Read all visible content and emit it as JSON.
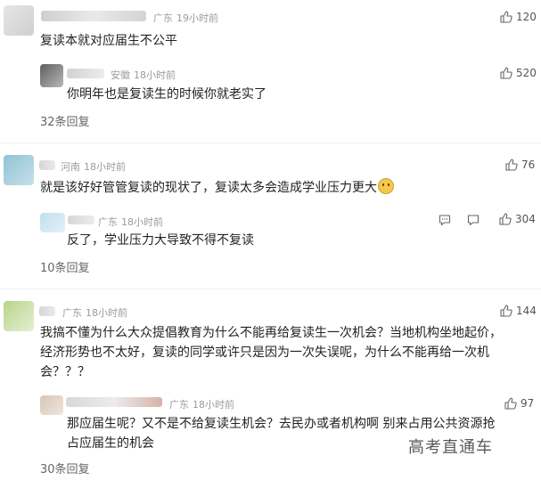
{
  "thread1": {
    "comment": {
      "location": "广东",
      "time": "19小时前",
      "text": "复读本就对应届生不公平",
      "likes": "120"
    },
    "reply": {
      "location": "安徽",
      "time": "18小时前",
      "text": "你明年也是复读生的时候你就老实了",
      "likes": "520"
    },
    "more_replies": "32条回复",
    "avatar_color": "#d9d9d9"
  },
  "thread2": {
    "comment": {
      "location": "河南",
      "time": "18小时前",
      "text": "就是该好好管管复读的现状了，复读太多会造成学业压力更大",
      "likes": "76",
      "emoji_icon": "smiling-face-emoji"
    },
    "reply": {
      "location": "广东",
      "time": "18小时前",
      "text": "反了，学业压力大导致不得不复读",
      "likes": "304"
    },
    "more_replies": "10条回复",
    "avatar_color": "#7fb4c9"
  },
  "thread3": {
    "comment": {
      "location": "广东",
      "time": "18小时前",
      "lines": [
        "我搞不懂为什么大众提倡教育为什么不能再给复读生一次机会？当地机构坐地起价，",
        "经济形势也不太好，复读的同学或许只是因为一次失误呢，为什么不能再给一次机",
        "会？？？"
      ],
      "likes": "144"
    },
    "reply": {
      "location": "广东",
      "time": "18小时前",
      "lines": [
        "那应届生呢？又不是不给复读生机会？去民办或者机构啊 别来占用公共资源抢",
        "占应届生的机会"
      ],
      "likes": "97"
    },
    "more_replies": "30条回复",
    "avatar_color": "#a9c97a"
  },
  "watermark": "高考直通车",
  "icons": {
    "like": "thumbs-up-icon",
    "comment": "comment-bubble-icon"
  },
  "colors": {
    "meta": "#9b9b9b",
    "text": "#222222",
    "icon": "#666666"
  }
}
